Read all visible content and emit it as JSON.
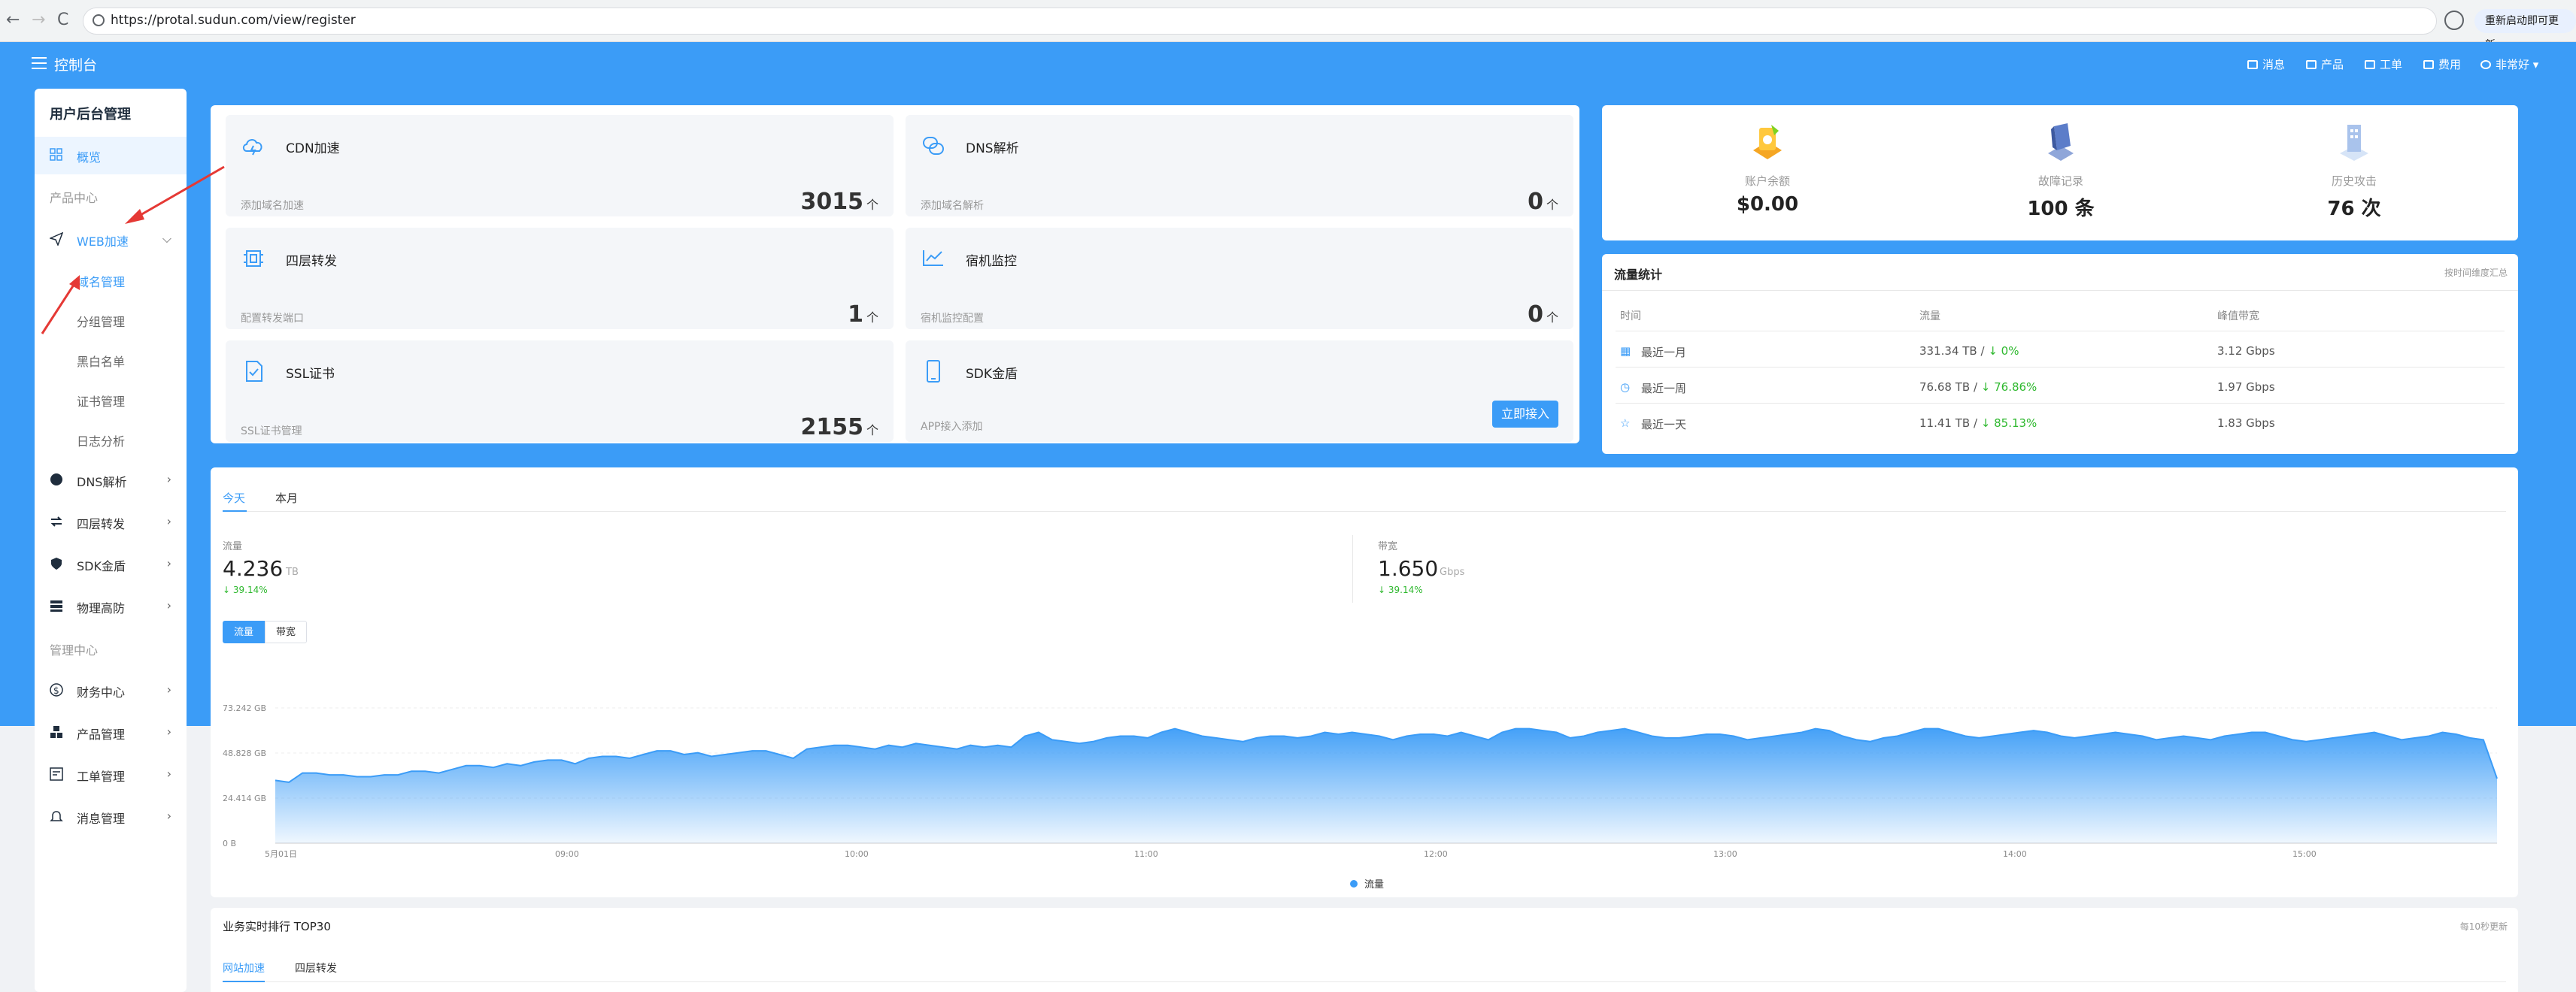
{
  "browser": {
    "url": "https://protal.sudun.com/view/register",
    "update_btn": "重新启动即可更新",
    "back": "←",
    "forward": "→",
    "reload": "C"
  },
  "header": {
    "title": "控制台",
    "nav": [
      {
        "label": "消息",
        "icon": "mail-icon"
      },
      {
        "label": "产品",
        "icon": "product-icon"
      },
      {
        "label": "工单",
        "icon": "ticket-icon"
      },
      {
        "label": "费用",
        "icon": "cost-icon"
      },
      {
        "label": "非常好",
        "icon": "user-icon"
      }
    ]
  },
  "sidebar": {
    "title": "用户后台管理",
    "overview": "概览",
    "sec_product": "产品中心",
    "web": "WEB加速",
    "web_sub": [
      "域名管理",
      "分组管理",
      "黑白名单",
      "证书管理",
      "日志分析"
    ],
    "items": [
      "DNS解析",
      "四层转发",
      "SDK金盾",
      "物理高防"
    ],
    "sec_manage": "管理中心",
    "manage_items": [
      "财务中心",
      "产品管理",
      "工单管理",
      "消息管理"
    ]
  },
  "quick": [
    {
      "title": "CDN加速",
      "sub": "添加域名加速",
      "value": "3015",
      "unit": "个",
      "icon": "cloud-icon"
    },
    {
      "title": "DNS解析",
      "sub": "添加域名解析",
      "value": "0",
      "unit": "个",
      "icon": "dns-icon"
    },
    {
      "title": "四层转发",
      "sub": "配置转发端口",
      "value": "1",
      "unit": "个",
      "icon": "chip-icon"
    },
    {
      "title": "宿机监控",
      "sub": "宿机监控配置",
      "value": "0",
      "unit": "个",
      "icon": "monitor-icon"
    },
    {
      "title": "SSL证书",
      "sub": "SSL证书管理",
      "value": "2155",
      "unit": "个",
      "icon": "cert-icon"
    },
    {
      "title": "SDK金盾",
      "sub": "APP接入添加",
      "btn": "立即接入",
      "icon": "phone-icon"
    }
  ],
  "stats": [
    {
      "label": "账户余额",
      "value": "$0.00"
    },
    {
      "label": "故障记录",
      "value": "100 条"
    },
    {
      "label": "历史攻击",
      "value": "76 次"
    }
  ],
  "traffic": {
    "title": "流量统计",
    "note": "按时间维度汇总",
    "headers": [
      "时间",
      "流量",
      "峰值带宽"
    ],
    "rows": [
      {
        "period": "最近一月",
        "traffic": "331.34 TB",
        "pct": "0%",
        "peak": "3.12 Gbps"
      },
      {
        "period": "最近一周",
        "traffic": "76.68 TB",
        "pct": "76.86%",
        "peak": "1.97 Gbps"
      },
      {
        "period": "最近一天",
        "traffic": "11.41 TB",
        "pct": "85.13%",
        "peak": "1.83 Gbps"
      }
    ]
  },
  "overview": {
    "tabs": [
      "今天",
      "本月"
    ],
    "flow_label": "流量",
    "flow_value": "4.236",
    "flow_unit": "TB",
    "flow_pct": "39.14%",
    "bw_label": "带宽",
    "bw_value": "1.650",
    "bw_unit": "Gbps",
    "bw_pct": "39.14%",
    "toggle": [
      "流量",
      "带宽"
    ]
  },
  "chart_data": {
    "type": "area",
    "x": [
      "5月01日",
      "09:00",
      "10:00",
      "11:00",
      "12:00",
      "13:00",
      "14:00",
      "15:00"
    ],
    "yticks": [
      "0 B",
      "24.414 GB",
      "48.828 GB",
      "73.242 GB"
    ],
    "ylim": [
      0,
      73.242
    ],
    "series": [
      {
        "name": "流量",
        "values": [
          34,
          33,
          38,
          38,
          37,
          37,
          36,
          36,
          37,
          37,
          39,
          39,
          38,
          40,
          42,
          42,
          41,
          43,
          42,
          44,
          45,
          45,
          43,
          46,
          47,
          47,
          46,
          48,
          50,
          50,
          48,
          49,
          47,
          48,
          49,
          50,
          50,
          48,
          46,
          51,
          52,
          53,
          53,
          52,
          51,
          53,
          52,
          54,
          53,
          52,
          51,
          53,
          52,
          53,
          52,
          58,
          60,
          56,
          55,
          54,
          55,
          57,
          58,
          58,
          57,
          60,
          62,
          60,
          58,
          57,
          56,
          55,
          57,
          58,
          58,
          57,
          58,
          60,
          59,
          60,
          59,
          58,
          56,
          58,
          59,
          59,
          58,
          60,
          58,
          56,
          60,
          62,
          62,
          61,
          60,
          57,
          58,
          60,
          61,
          62,
          60,
          58,
          57,
          57,
          58,
          59,
          59,
          58,
          56,
          57,
          58,
          59,
          60,
          62,
          61,
          58,
          56,
          55,
          57,
          58,
          60,
          62,
          62,
          60,
          58,
          57,
          58,
          59,
          60,
          61,
          60,
          58,
          57,
          58,
          59,
          60,
          59,
          58,
          56,
          57,
          58,
          57,
          56,
          58,
          59,
          60,
          60,
          58,
          56,
          55,
          56,
          57,
          58,
          59,
          60,
          58,
          56,
          57,
          58,
          60,
          59,
          57,
          56,
          35
        ]
      }
    ],
    "legend": "bottom-center"
  },
  "ranking": {
    "title": "业务实时排行 TOP30",
    "note": "每10秒更新",
    "tabs": [
      "网站加速",
      "四层转发"
    ]
  },
  "colors": {
    "brand": "#3b9cf7",
    "up": "#2eb82e"
  }
}
